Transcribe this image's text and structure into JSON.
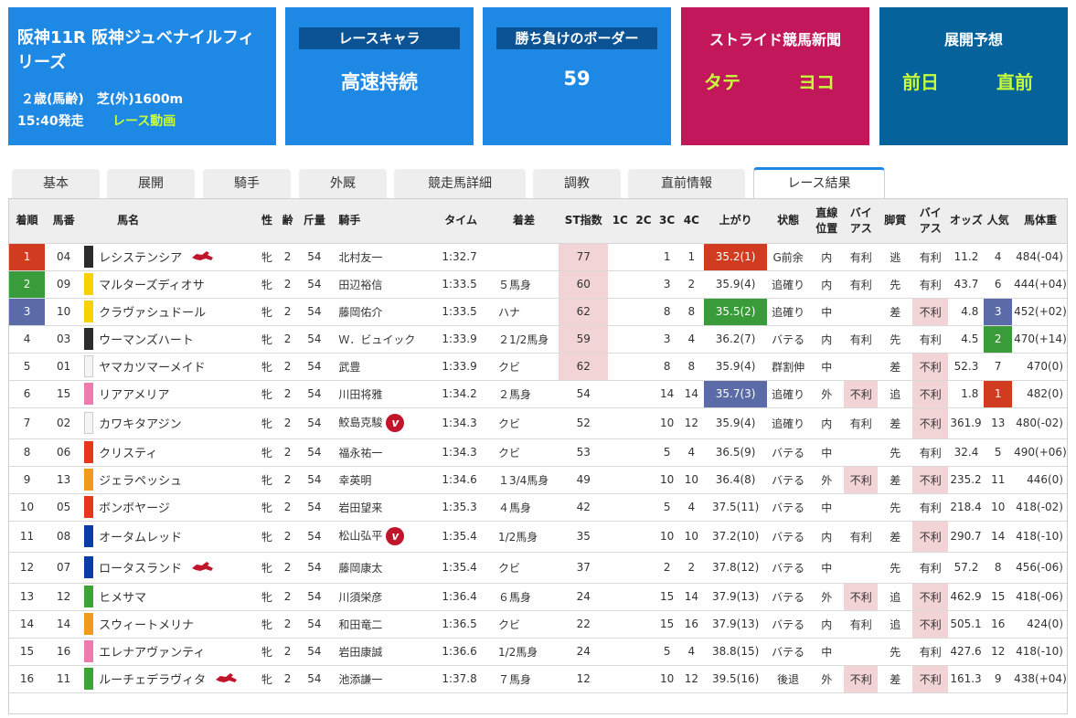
{
  "race": {
    "title": "阪神11R 阪神ジュベナイルフィリーズ",
    "conditions": "２歳(馬齢)　芝(外)1600m",
    "start": "15:40発走",
    "video": "レース動画"
  },
  "chara": {
    "label": "レースキャラ",
    "value": "高速持続"
  },
  "border": {
    "label": "勝ち負けのボーダー",
    "value": "59"
  },
  "news": {
    "heading": "ストライド競馬新聞",
    "left": "タテ",
    "right": "ヨコ"
  },
  "tenkai": {
    "heading": "展開予想",
    "left": "前日",
    "right": "直前"
  },
  "tabs": [
    "基本",
    "展開",
    "騎手",
    "外厩",
    "競走馬詳細",
    "調教",
    "直前情報",
    "レース結果"
  ],
  "columns": {
    "rank": "着順",
    "num": "馬番",
    "name": "馬名",
    "sex": "性",
    "age": "齢",
    "weight": "斤量",
    "jockey": "騎手",
    "time": "タイム",
    "margin": "着差",
    "st": "ST指数",
    "c1": "1C",
    "c2": "2C",
    "c3": "3C",
    "c4": "4C",
    "last": "上がり",
    "state": "状態",
    "pos1": "直線",
    "pos2": "位置",
    "bias1": "バイ",
    "bias2": "アス",
    "style": "脚質",
    "bias3": "バイ",
    "bias4": "アス",
    "odds": "オッズ",
    "pop": "人気",
    "bw": "馬体重"
  },
  "colors": {
    "waku1": "#2b2b2b",
    "waku2": "#f5f5f5",
    "waku3": "#e8351b",
    "waku4": "#0b3ba7",
    "waku5": "#f7d100",
    "waku6": "#3aa535",
    "waku7": "#f39a1e",
    "waku8": "#ef7ab0",
    "rank1": "#d13b1f",
    "rank2": "#3a9b3a",
    "rank3": "#5a6ba8"
  },
  "rows": [
    {
      "rank": "1",
      "num": "04",
      "waku": "waku1",
      "name": "レシステンシア",
      "icon": "horse",
      "sex": "牝",
      "age": "2",
      "wt": "54",
      "jockey": "北村友一",
      "jicon": "",
      "time": "1:32.7",
      "margin": "",
      "st": "77",
      "stPink": true,
      "c1": "",
      "c2": "",
      "c3": "1",
      "c4": "1",
      "last": "35.2(1)",
      "lastHl": "red",
      "state": "G前余",
      "pos": "内",
      "bias1": "有利",
      "bias1Pink": false,
      "style": "逃",
      "bias2": "有利",
      "bias2Pink": false,
      "odds": "11.2",
      "pop": "4",
      "popHl": "",
      "bw": "484(-04)"
    },
    {
      "rank": "2",
      "num": "09",
      "waku": "waku5",
      "name": "マルターズディオサ",
      "icon": "",
      "sex": "牝",
      "age": "2",
      "wt": "54",
      "jockey": "田辺裕信",
      "jicon": "",
      "time": "1:33.5",
      "margin": "５馬身",
      "st": "60",
      "stPink": true,
      "c1": "",
      "c2": "",
      "c3": "3",
      "c4": "2",
      "last": "35.9(4)",
      "lastHl": "",
      "state": "追確り",
      "pos": "内",
      "bias1": "有利",
      "bias1Pink": false,
      "style": "先",
      "bias2": "有利",
      "bias2Pink": false,
      "odds": "43.7",
      "pop": "6",
      "popHl": "",
      "bw": "444(+04)"
    },
    {
      "rank": "3",
      "num": "10",
      "waku": "waku5",
      "name": "クラヴァシュドール",
      "icon": "",
      "sex": "牝",
      "age": "2",
      "wt": "54",
      "jockey": "藤岡佑介",
      "jicon": "",
      "time": "1:33.5",
      "margin": "ハナ",
      "st": "62",
      "stPink": true,
      "c1": "",
      "c2": "",
      "c3": "8",
      "c4": "8",
      "last": "35.5(2)",
      "lastHl": "green",
      "state": "追確り",
      "pos": "中",
      "bias1": "",
      "bias1Pink": false,
      "style": "差",
      "bias2": "不利",
      "bias2Pink": true,
      "odds": "4.8",
      "pop": "3",
      "popHl": "blue",
      "bw": "452(+02)"
    },
    {
      "rank": "4",
      "num": "03",
      "waku": "waku1",
      "name": "ウーマンズハート",
      "icon": "",
      "sex": "牝",
      "age": "2",
      "wt": "54",
      "jockey": "Ｗ．ビュイック",
      "jicon": "",
      "time": "1:33.9",
      "margin": "２1/2馬身",
      "st": "59",
      "stPink": true,
      "c1": "",
      "c2": "",
      "c3": "3",
      "c4": "4",
      "last": "36.2(7)",
      "lastHl": "",
      "state": "バテる",
      "pos": "内",
      "bias1": "有利",
      "bias1Pink": false,
      "style": "先",
      "bias2": "有利",
      "bias2Pink": false,
      "odds": "4.5",
      "pop": "2",
      "popHl": "green",
      "bw": "470(+14)"
    },
    {
      "rank": "5",
      "num": "01",
      "waku": "waku2",
      "name": "ヤマカツマーメイド",
      "icon": "",
      "sex": "牝",
      "age": "2",
      "wt": "54",
      "jockey": "武豊",
      "jicon": "",
      "time": "1:33.9",
      "margin": "クビ",
      "st": "62",
      "stPink": true,
      "c1": "",
      "c2": "",
      "c3": "8",
      "c4": "8",
      "last": "35.9(4)",
      "lastHl": "",
      "state": "群割伸",
      "pos": "中",
      "bias1": "",
      "bias1Pink": false,
      "style": "差",
      "bias2": "不利",
      "bias2Pink": true,
      "odds": "52.3",
      "pop": "7",
      "popHl": "",
      "bw": "470(0)"
    },
    {
      "rank": "6",
      "num": "15",
      "waku": "waku8",
      "name": "リアアメリア",
      "icon": "",
      "sex": "牝",
      "age": "2",
      "wt": "54",
      "jockey": "川田将雅",
      "jicon": "",
      "time": "1:34.2",
      "margin": "２馬身",
      "st": "54",
      "stPink": false,
      "c1": "",
      "c2": "",
      "c3": "14",
      "c4": "14",
      "last": "35.7(3)",
      "lastHl": "blue",
      "state": "追確り",
      "pos": "外",
      "bias1": "不利",
      "bias1Pink": true,
      "style": "追",
      "bias2": "不利",
      "bias2Pink": true,
      "odds": "1.8",
      "pop": "1",
      "popHl": "red",
      "bw": "482(0)"
    },
    {
      "rank": "7",
      "num": "02",
      "waku": "waku2",
      "name": "カワキタアジン",
      "icon": "",
      "sex": "牝",
      "age": "2",
      "wt": "54",
      "jockey": "鮫島克駿",
      "jicon": "v",
      "time": "1:34.3",
      "margin": "クビ",
      "st": "52",
      "stPink": false,
      "c1": "",
      "c2": "",
      "c3": "10",
      "c4": "12",
      "last": "35.9(4)",
      "lastHl": "",
      "state": "追確り",
      "pos": "内",
      "bias1": "有利",
      "bias1Pink": false,
      "style": "差",
      "bias2": "不利",
      "bias2Pink": true,
      "odds": "361.9",
      "pop": "13",
      "popHl": "",
      "bw": "480(-02)"
    },
    {
      "rank": "8",
      "num": "06",
      "waku": "waku3",
      "name": "クリスティ",
      "icon": "",
      "sex": "牝",
      "age": "2",
      "wt": "54",
      "jockey": "福永祐一",
      "jicon": "",
      "time": "1:34.3",
      "margin": "クビ",
      "st": "53",
      "stPink": false,
      "c1": "",
      "c2": "",
      "c3": "5",
      "c4": "4",
      "last": "36.5(9)",
      "lastHl": "",
      "state": "バテる",
      "pos": "中",
      "bias1": "",
      "bias1Pink": false,
      "style": "先",
      "bias2": "有利",
      "bias2Pink": false,
      "odds": "32.4",
      "pop": "5",
      "popHl": "",
      "bw": "490(+06)"
    },
    {
      "rank": "9",
      "num": "13",
      "waku": "waku7",
      "name": "ジェラペッシュ",
      "icon": "",
      "sex": "牝",
      "age": "2",
      "wt": "54",
      "jockey": "幸英明",
      "jicon": "",
      "time": "1:34.6",
      "margin": "１3/4馬身",
      "st": "49",
      "stPink": false,
      "c1": "",
      "c2": "",
      "c3": "10",
      "c4": "10",
      "last": "36.4(8)",
      "lastHl": "",
      "state": "バテる",
      "pos": "外",
      "bias1": "不利",
      "bias1Pink": true,
      "style": "差",
      "bias2": "不利",
      "bias2Pink": true,
      "odds": "235.2",
      "pop": "11",
      "popHl": "",
      "bw": "446(0)"
    },
    {
      "rank": "10",
      "num": "05",
      "waku": "waku3",
      "name": "ボンボヤージ",
      "icon": "",
      "sex": "牝",
      "age": "2",
      "wt": "54",
      "jockey": "岩田望来",
      "jicon": "",
      "time": "1:35.3",
      "margin": "４馬身",
      "st": "42",
      "stPink": false,
      "c1": "",
      "c2": "",
      "c3": "5",
      "c4": "4",
      "last": "37.5(11)",
      "lastHl": "",
      "state": "バテる",
      "pos": "中",
      "bias1": "",
      "bias1Pink": false,
      "style": "先",
      "bias2": "有利",
      "bias2Pink": false,
      "odds": "218.4",
      "pop": "10",
      "popHl": "",
      "bw": "418(-02)"
    },
    {
      "rank": "11",
      "num": "08",
      "waku": "waku4",
      "name": "オータムレッド",
      "icon": "",
      "sex": "牝",
      "age": "2",
      "wt": "54",
      "jockey": "松山弘平",
      "jicon": "v",
      "time": "1:35.4",
      "margin": "1/2馬身",
      "st": "35",
      "stPink": false,
      "c1": "",
      "c2": "",
      "c3": "10",
      "c4": "10",
      "last": "37.2(10)",
      "lastHl": "",
      "state": "バテる",
      "pos": "内",
      "bias1": "有利",
      "bias1Pink": false,
      "style": "差",
      "bias2": "不利",
      "bias2Pink": true,
      "odds": "290.7",
      "pop": "14",
      "popHl": "",
      "bw": "418(-10)"
    },
    {
      "rank": "12",
      "num": "07",
      "waku": "waku4",
      "name": "ロータスランド",
      "icon": "horse",
      "sex": "牝",
      "age": "2",
      "wt": "54",
      "jockey": "藤岡康太",
      "jicon": "",
      "time": "1:35.4",
      "margin": "クビ",
      "st": "37",
      "stPink": false,
      "c1": "",
      "c2": "",
      "c3": "2",
      "c4": "2",
      "last": "37.8(12)",
      "lastHl": "",
      "state": "バテる",
      "pos": "中",
      "bias1": "",
      "bias1Pink": false,
      "style": "先",
      "bias2": "有利",
      "bias2Pink": false,
      "odds": "57.2",
      "pop": "8",
      "popHl": "",
      "bw": "456(-06)"
    },
    {
      "rank": "13",
      "num": "12",
      "waku": "waku6",
      "name": "ヒメサマ",
      "icon": "",
      "sex": "牝",
      "age": "2",
      "wt": "54",
      "jockey": "川須栄彦",
      "jicon": "",
      "time": "1:36.4",
      "margin": "６馬身",
      "st": "24",
      "stPink": false,
      "c1": "",
      "c2": "",
      "c3": "15",
      "c4": "14",
      "last": "37.9(13)",
      "lastHl": "",
      "state": "バテる",
      "pos": "外",
      "bias1": "不利",
      "bias1Pink": true,
      "style": "追",
      "bias2": "不利",
      "bias2Pink": true,
      "odds": "462.9",
      "pop": "15",
      "popHl": "",
      "bw": "418(-06)"
    },
    {
      "rank": "14",
      "num": "14",
      "waku": "waku7",
      "name": "スウィートメリナ",
      "icon": "",
      "sex": "牝",
      "age": "2",
      "wt": "54",
      "jockey": "和田竜二",
      "jicon": "",
      "time": "1:36.5",
      "margin": "クビ",
      "st": "22",
      "stPink": false,
      "c1": "",
      "c2": "",
      "c3": "15",
      "c4": "16",
      "last": "37.9(13)",
      "lastHl": "",
      "state": "バテる",
      "pos": "内",
      "bias1": "有利",
      "bias1Pink": false,
      "style": "追",
      "bias2": "不利",
      "bias2Pink": true,
      "odds": "505.1",
      "pop": "16",
      "popHl": "",
      "bw": "424(0)"
    },
    {
      "rank": "15",
      "num": "16",
      "waku": "waku8",
      "name": "エレナアヴァンティ",
      "icon": "",
      "sex": "牝",
      "age": "2",
      "wt": "54",
      "jockey": "岩田康誠",
      "jicon": "",
      "time": "1:36.6",
      "margin": "1/2馬身",
      "st": "24",
      "stPink": false,
      "c1": "",
      "c2": "",
      "c3": "5",
      "c4": "4",
      "last": "38.8(15)",
      "lastHl": "",
      "state": "バテる",
      "pos": "中",
      "bias1": "",
      "bias1Pink": false,
      "style": "先",
      "bias2": "有利",
      "bias2Pink": false,
      "odds": "427.6",
      "pop": "12",
      "popHl": "",
      "bw": "418(-10)"
    },
    {
      "rank": "16",
      "num": "11",
      "waku": "waku6",
      "name": "ルーチェデラヴィタ",
      "icon": "horse",
      "sex": "牝",
      "age": "2",
      "wt": "54",
      "jockey": "池添謙一",
      "jicon": "",
      "time": "1:37.8",
      "margin": "７馬身",
      "st": "12",
      "stPink": false,
      "c1": "",
      "c2": "",
      "c3": "10",
      "c4": "12",
      "last": "39.5(16)",
      "lastHl": "",
      "state": "後退",
      "pos": "外",
      "bias1": "不利",
      "bias1Pink": true,
      "style": "差",
      "bias2": "不利",
      "bias2Pink": true,
      "odds": "161.3",
      "pop": "9",
      "popHl": "",
      "bw": "438(+04)"
    }
  ]
}
